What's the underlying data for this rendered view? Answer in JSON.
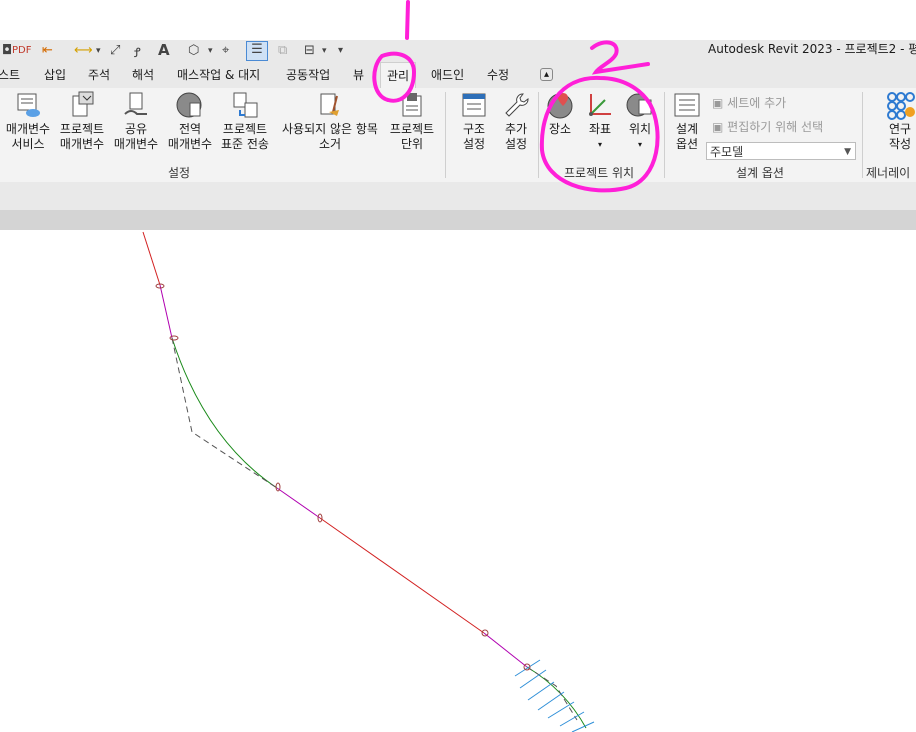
{
  "window_title": "Autodesk Revit 2023 - 프로젝트2 - 평",
  "annotations": {
    "mark1": "1",
    "mark2": "2"
  },
  "colors": {
    "annotation": "#ff1fd8",
    "alignment_red": "#d22020",
    "alignment_green": "#1a8a1a",
    "alignment_magenta": "#b000b0"
  },
  "tabs": [
    "스트",
    "삽입",
    "주석",
    "해석",
    "매스작업 & 대지",
    "공동작업",
    "뷰",
    "관리",
    "애드인",
    "수정"
  ],
  "active_tab": "관리",
  "ribbon": {
    "settings_buttons": [
      {
        "line1": "매개변수",
        "line2": "서비스",
        "icon": "parameter-service-icon"
      },
      {
        "line1": "프로젝트",
        "line2": "매개변수",
        "icon": "project-parameters-icon"
      },
      {
        "line1": "공유",
        "line2": "매개변수",
        "icon": "shared-parameters-icon"
      },
      {
        "line1": "전역",
        "line2": "매개변수",
        "icon": "global-parameters-icon"
      },
      {
        "line1": "프로젝트",
        "line2": "표준 전송",
        "icon": "transfer-standards-icon"
      },
      {
        "line1": "사용되지 않은 항목",
        "line2": "소거",
        "icon": "purge-unused-icon"
      },
      {
        "line1": "프로젝트",
        "line2": "단위",
        "icon": "project-units-icon"
      },
      {
        "line1": "구조",
        "line2": "설정",
        "icon": "structural-settings-icon"
      },
      {
        "line1": "추가",
        "line2": "설정",
        "icon": "additional-settings-icon"
      }
    ],
    "settings_panel_label": "설정",
    "location_buttons": [
      {
        "line1": "장소",
        "icon": "location-globe-icon"
      },
      {
        "line1": "좌표",
        "icon": "coordinates-icon"
      },
      {
        "line1": "위치",
        "icon": "position-icon"
      }
    ],
    "location_panel_label": "프로젝트 위치",
    "design_options_button": {
      "line1": "설계",
      "line2": "옵션"
    },
    "design_set_add": "세트에 추가",
    "design_pick_edit": "편집하기 위해 선택",
    "design_option_value": "주모델",
    "design_panel_label": "설계 옵션",
    "generator_button": {
      "line1": "연구",
      "line2": "작성"
    },
    "generator_panel_label": "제너레이"
  }
}
